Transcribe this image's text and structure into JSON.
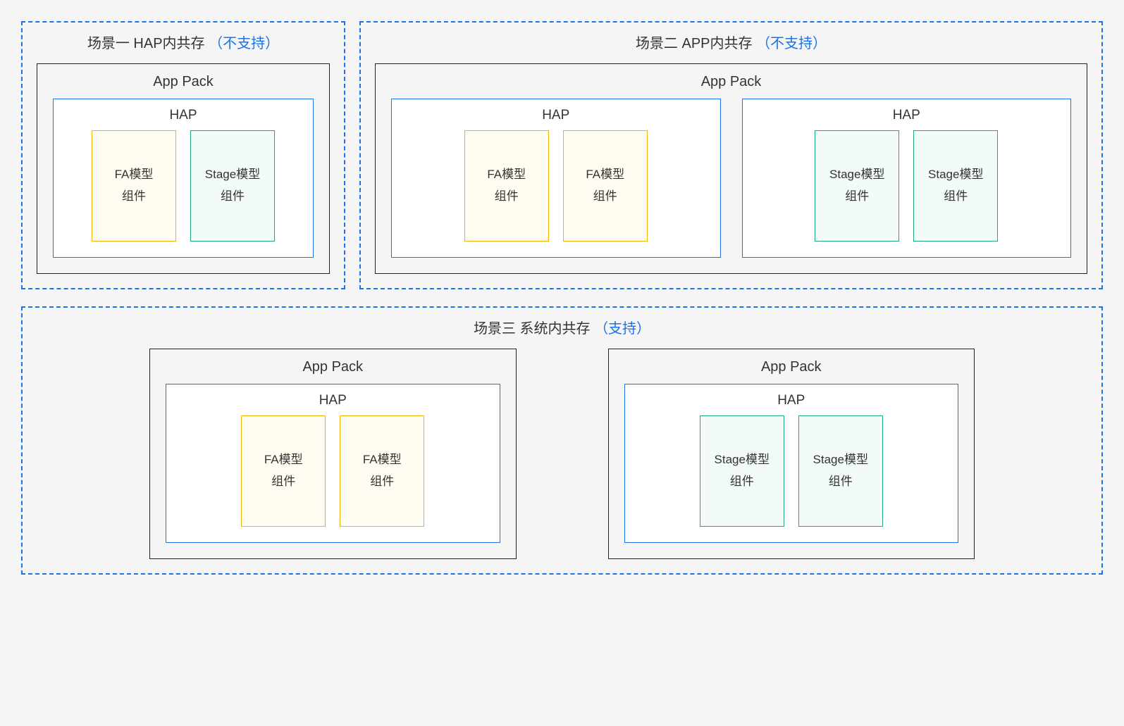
{
  "scenarios": [
    {
      "title_prefix": "场景一 HAP内共存",
      "title_note": "（不支持）",
      "app_packs": [
        {
          "label": "App Pack",
          "haps": [
            {
              "label": "HAP",
              "components": [
                {
                  "type": "fa",
                  "line1": "FA模型",
                  "line2": "组件"
                },
                {
                  "type": "stage",
                  "line1": "Stage模型",
                  "line2": "组件"
                }
              ]
            }
          ]
        }
      ]
    },
    {
      "title_prefix": "场景二 APP内共存",
      "title_note": "（不支持）",
      "app_packs": [
        {
          "label": "App Pack",
          "haps": [
            {
              "label": "HAP",
              "components": [
                {
                  "type": "fa",
                  "line1": "FA模型",
                  "line2": "组件"
                },
                {
                  "type": "fa",
                  "line1": "FA模型",
                  "line2": "组件"
                }
              ]
            },
            {
              "label": "HAP",
              "components": [
                {
                  "type": "stage",
                  "line1": "Stage模型",
                  "line2": "组件"
                },
                {
                  "type": "stage",
                  "line1": "Stage模型",
                  "line2": "组件"
                }
              ]
            }
          ]
        }
      ]
    },
    {
      "title_prefix": "场景三 系统内共存",
      "title_note": "（支持）",
      "app_packs": [
        {
          "label": "App Pack",
          "haps": [
            {
              "label": "HAP",
              "components": [
                {
                  "type": "fa",
                  "line1": "FA模型",
                  "line2": "组件"
                },
                {
                  "type": "fa",
                  "line1": "FA模型",
                  "line2": "组件"
                }
              ]
            }
          ]
        },
        {
          "label": "App Pack",
          "haps": [
            {
              "label": "HAP",
              "components": [
                {
                  "type": "stage",
                  "line1": "Stage模型",
                  "line2": "组件"
                },
                {
                  "type": "stage",
                  "line1": "Stage模型",
                  "line2": "组件"
                }
              ]
            }
          ]
        }
      ]
    }
  ]
}
